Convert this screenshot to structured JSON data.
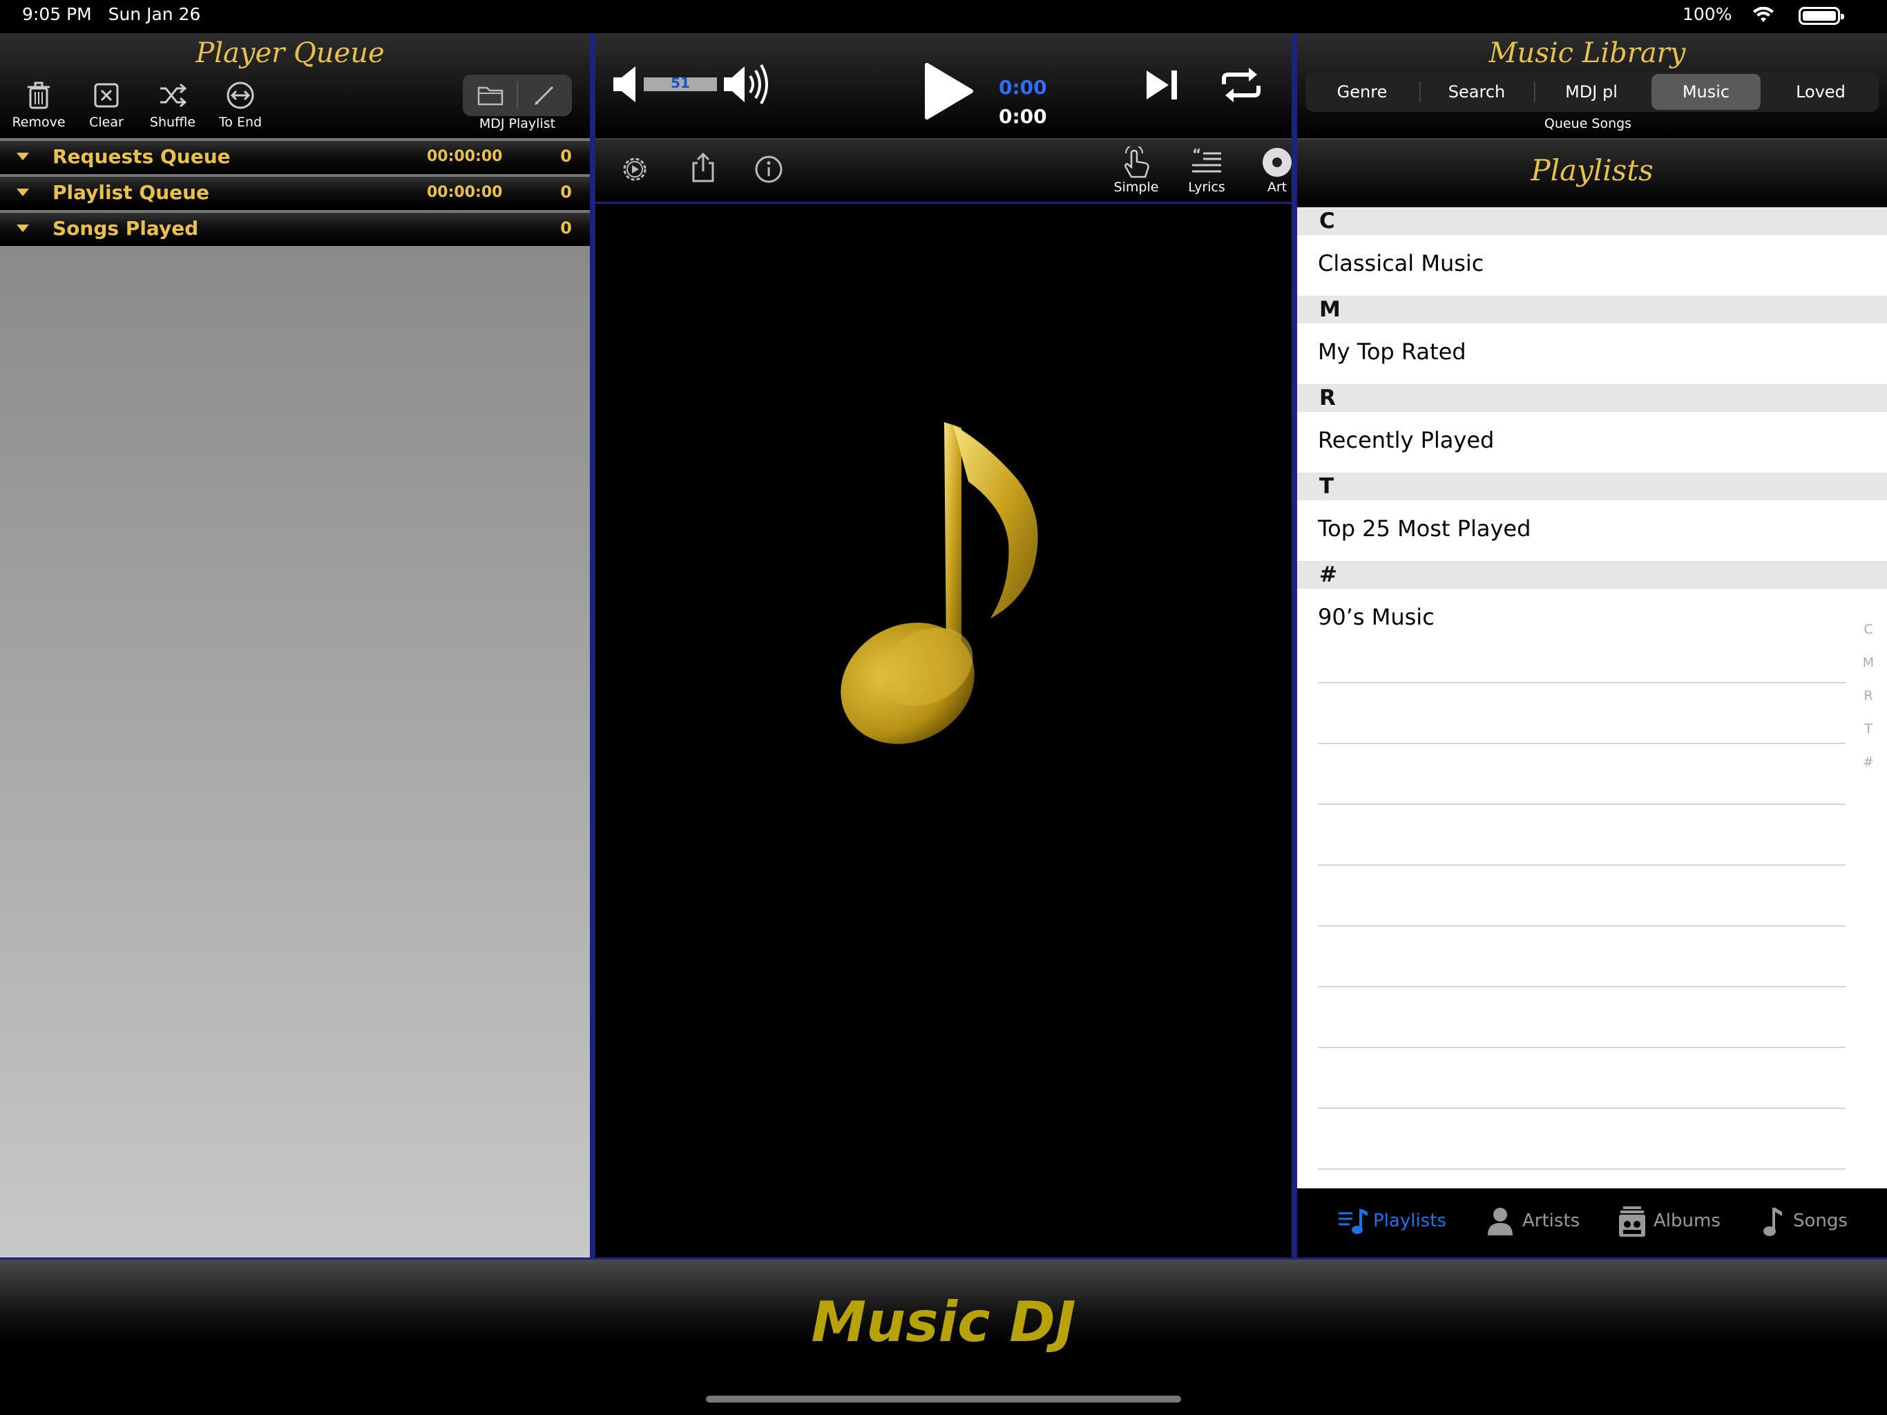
{
  "status": {
    "time": "9:05 PM",
    "date": "Sun Jan 26",
    "battery": "100%"
  },
  "left_panel": {
    "title": "Player Queue",
    "tools": [
      {
        "label": "Remove",
        "icon": "trash-icon"
      },
      {
        "label": "Clear",
        "icon": "clear-box-icon"
      },
      {
        "label": "Shuffle",
        "icon": "shuffle-icon"
      },
      {
        "label": "To End",
        "icon": "to-end-icon"
      }
    ],
    "mdj_label": "MDJ Playlist",
    "queues": [
      {
        "name": "Requests Queue",
        "time": "00:00:00",
        "count": "0"
      },
      {
        "name": "Playlist Queue",
        "time": "00:00:00",
        "count": "0"
      },
      {
        "name": "Songs Played",
        "time": "",
        "count": "0"
      }
    ]
  },
  "player": {
    "volume": "51",
    "time_current": "0:00",
    "time_total": "0:00",
    "tools": [
      {
        "label": "Simple",
        "icon": "touch-icon"
      },
      {
        "label": "Lyrics",
        "icon": "lyrics-icon"
      },
      {
        "label": "Art",
        "icon": "disc-icon"
      }
    ]
  },
  "right_panel": {
    "title": "Music Library",
    "segments": [
      "Genre",
      "Search",
      "MDJ pl",
      "Music",
      "Loved"
    ],
    "selected_segment": "Music",
    "queue_songs_label": "Queue Songs",
    "list_title": "Playlists",
    "sections": [
      {
        "letter": "C",
        "items": [
          "Classical Music"
        ]
      },
      {
        "letter": "M",
        "items": [
          "My Top Rated"
        ]
      },
      {
        "letter": "R",
        "items": [
          "Recently Played"
        ]
      },
      {
        "letter": "T",
        "items": [
          "Top 25 Most Played"
        ]
      },
      {
        "letter": "#",
        "items": [
          "90’s Music"
        ]
      }
    ],
    "index": [
      "C",
      "M",
      "R",
      "T",
      "#"
    ],
    "tabs": [
      "Playlists",
      "Artists",
      "Albums",
      "Songs"
    ],
    "active_tab": "Playlists"
  },
  "brand": "Music DJ",
  "colors": {
    "gold": "#e8c04a",
    "brand_gold": "#b8a20a",
    "accent_blue": "#1a73e8",
    "time_blue": "#2f6dff",
    "separator": "#1a237e"
  }
}
